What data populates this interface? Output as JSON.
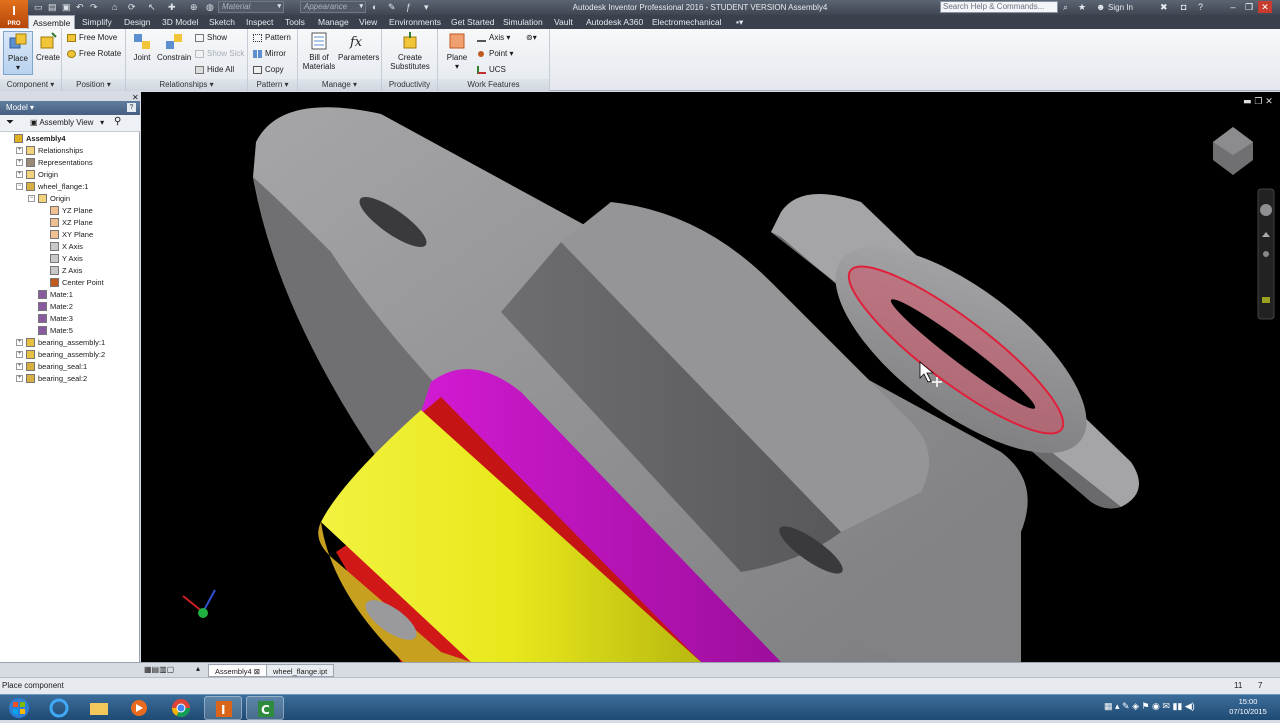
{
  "title_bar": {
    "title": "Autodesk Inventor Professional 2016 - STUDENT VERSION    Assembly4",
    "material_combo": "Material",
    "appearance_combo": "Appearance",
    "help_search_placeholder": "Search Help & Commands...",
    "sign_in": "Sign In"
  },
  "tabs": [
    "Assemble",
    "Simplify",
    "Design",
    "3D Model",
    "Sketch",
    "Inspect",
    "Tools",
    "Manage",
    "View",
    "Environments",
    "Get Started",
    "Simulation",
    "Vault",
    "Autodesk A360",
    "Electromechanical"
  ],
  "active_tab": "Assemble",
  "ribbon": {
    "component": {
      "title": "Component",
      "place": "Place",
      "create": "Create"
    },
    "position": {
      "title": "Position",
      "free_move": "Free Move",
      "free_rotate": "Free Rotate"
    },
    "relationships": {
      "title": "Relationships",
      "joint": "Joint",
      "constrain": "Constrain",
      "show": "Show",
      "show_sick": "Show Sick",
      "hide_all": "Hide All"
    },
    "pattern": {
      "title": "Pattern",
      "pattern": "Pattern",
      "mirror": "Mirror",
      "copy": "Copy"
    },
    "manage": {
      "title": "Manage",
      "bill_of_materials": "Bill of Materials",
      "parameters": "Parameters"
    },
    "productivity": {
      "title": "Productivity",
      "create_substitutes": "Create Substitutes"
    },
    "work_features": {
      "title": "Work Features",
      "plane": "Plane",
      "axis": "Axis",
      "point": "Point",
      "ucs": "UCS"
    }
  },
  "browser": {
    "header": "Model",
    "view_label": "Assembly View",
    "tree": [
      {
        "label": "Assembly4",
        "depth": 0,
        "icon": "assembly-icon",
        "expander": ""
      },
      {
        "label": "Relationships",
        "depth": 1,
        "icon": "folder-icon",
        "expander": "+"
      },
      {
        "label": "Representations",
        "depth": 1,
        "icon": "representations-icon",
        "expander": "+"
      },
      {
        "label": "Origin",
        "depth": 1,
        "icon": "folder-icon",
        "expander": "+"
      },
      {
        "label": "wheel_flange:1",
        "depth": 1,
        "icon": "part-icon",
        "expander": "-"
      },
      {
        "label": "Origin",
        "depth": 2,
        "icon": "folder-icon",
        "expander": "-"
      },
      {
        "label": "YZ Plane",
        "depth": 3,
        "icon": "plane-icon",
        "expander": ""
      },
      {
        "label": "XZ Plane",
        "depth": 3,
        "icon": "plane-icon",
        "expander": ""
      },
      {
        "label": "XY Plane",
        "depth": 3,
        "icon": "plane-icon",
        "expander": ""
      },
      {
        "label": "X Axis",
        "depth": 3,
        "icon": "axis-icon",
        "expander": ""
      },
      {
        "label": "Y Axis",
        "depth": 3,
        "icon": "axis-icon",
        "expander": ""
      },
      {
        "label": "Z Axis",
        "depth": 3,
        "icon": "axis-icon",
        "expander": ""
      },
      {
        "label": "Center Point",
        "depth": 3,
        "icon": "point-icon",
        "expander": ""
      },
      {
        "label": "Mate:1",
        "depth": 2,
        "icon": "mate-icon",
        "expander": ""
      },
      {
        "label": "Mate:2",
        "depth": 2,
        "icon": "mate-icon",
        "expander": ""
      },
      {
        "label": "Mate:3",
        "depth": 2,
        "icon": "mate-icon",
        "expander": ""
      },
      {
        "label": "Mate:5",
        "depth": 2,
        "icon": "mate-icon",
        "expander": ""
      },
      {
        "label": "bearing_assembly:1",
        "depth": 1,
        "icon": "subassembly-icon",
        "expander": "+"
      },
      {
        "label": "bearing_assembly:2",
        "depth": 1,
        "icon": "subassembly-icon",
        "expander": "+"
      },
      {
        "label": "bearing_seal:1",
        "depth": 1,
        "icon": "part-icon",
        "expander": "+"
      },
      {
        "label": "bearing_seal:2",
        "depth": 1,
        "icon": "part-icon",
        "expander": "+"
      }
    ]
  },
  "doc_tabs": [
    "Assembly4",
    "wheel_flange.ipt"
  ],
  "active_doc_tab": "Assembly4",
  "status": {
    "message": "Place component",
    "count_a": "11",
    "count_b": "7"
  },
  "taskbar": {
    "time": "15:00",
    "date": "07/10/2015"
  },
  "colors": {
    "flange": "#8a8a8c",
    "seal_yellow": "#e6e61e",
    "seal_magenta": "#c010c0",
    "bearing_red": "#d01818",
    "highlight": "#e0203a"
  }
}
